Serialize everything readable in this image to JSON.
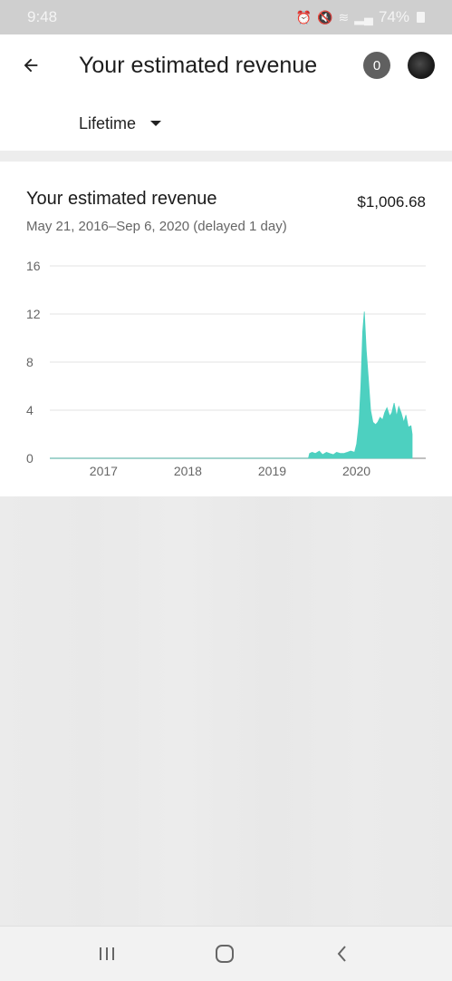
{
  "status_bar": {
    "time": "9:48",
    "battery": "74%"
  },
  "header": {
    "title": "Your estimated revenue",
    "notification_count": "0"
  },
  "period": {
    "selected": "Lifetime"
  },
  "card": {
    "title": "Your estimated revenue",
    "total": "$1,006.68",
    "date_range": "May 21, 2016–Sep 6, 2020 (delayed 1 day)"
  },
  "chart_data": {
    "type": "area",
    "title": "",
    "xlabel": "",
    "ylabel": "",
    "ylim": [
      0,
      16
    ],
    "yticks": [
      "16",
      "12",
      "8",
      "4",
      "0"
    ],
    "xticks": [
      "2017",
      "2018",
      "2019",
      "2020"
    ],
    "grid": true,
    "color": "#4dd0c0",
    "series": [
      {
        "x": [
          "2016-05-21",
          "2017-01-01",
          "2018-01-01",
          "2019-01-01",
          "2019-06-15",
          "2019-06-20",
          "2019-07-01",
          "2019-07-15",
          "2019-08-01",
          "2019-08-15",
          "2019-09-01",
          "2019-09-15",
          "2019-10-01",
          "2019-10-15",
          "2019-11-01",
          "2019-11-15",
          "2019-12-01",
          "2019-12-15",
          "2020-01-01",
          "2020-01-10",
          "2020-01-20",
          "2020-01-28",
          "2020-02-05",
          "2020-02-12",
          "2020-02-20",
          "2020-03-01",
          "2020-03-10",
          "2020-03-20",
          "2020-04-01",
          "2020-04-10",
          "2020-04-20",
          "2020-05-01",
          "2020-05-10",
          "2020-05-20",
          "2020-06-01",
          "2020-06-10",
          "2020-06-20",
          "2020-07-01",
          "2020-07-10",
          "2020-07-20",
          "2020-08-01",
          "2020-08-10",
          "2020-08-20",
          "2020-09-01",
          "2020-09-06"
        ],
        "values": [
          0,
          0,
          0,
          0,
          0,
          0.4,
          0.5,
          0.4,
          0.6,
          0.3,
          0.5,
          0.4,
          0.3,
          0.5,
          0.4,
          0.4,
          0.5,
          0.6,
          0.5,
          1.2,
          3.0,
          6.0,
          10.5,
          12.2,
          9.0,
          6.5,
          4.0,
          3.0,
          2.8,
          3.0,
          3.4,
          3.2,
          3.8,
          4.2,
          3.5,
          3.8,
          4.6,
          3.5,
          4.3,
          3.8,
          3.0,
          3.6,
          2.6,
          2.7,
          2.0
        ]
      }
    ]
  },
  "nav": {
    "recents_icon": "recents-icon",
    "home_icon": "home-icon",
    "back_icon": "back-icon"
  }
}
